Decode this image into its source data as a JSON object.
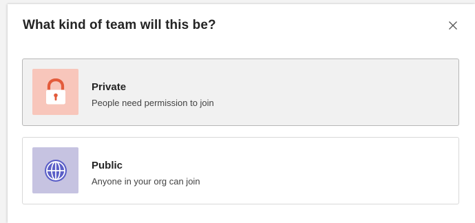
{
  "dialog": {
    "title": "What kind of team will this be?",
    "close_icon": "close-icon"
  },
  "options": [
    {
      "name": "Private",
      "description": "People need permission to join",
      "icon": "lock-icon",
      "tile_color": "#f8c6bb",
      "icon_color": "#e35b3b",
      "selected": true
    },
    {
      "name": "Public",
      "description": "Anyone in your org can join",
      "icon": "globe-icon",
      "tile_color": "#c6c3e1",
      "icon_color": "#5b5fc7",
      "selected": false
    }
  ]
}
